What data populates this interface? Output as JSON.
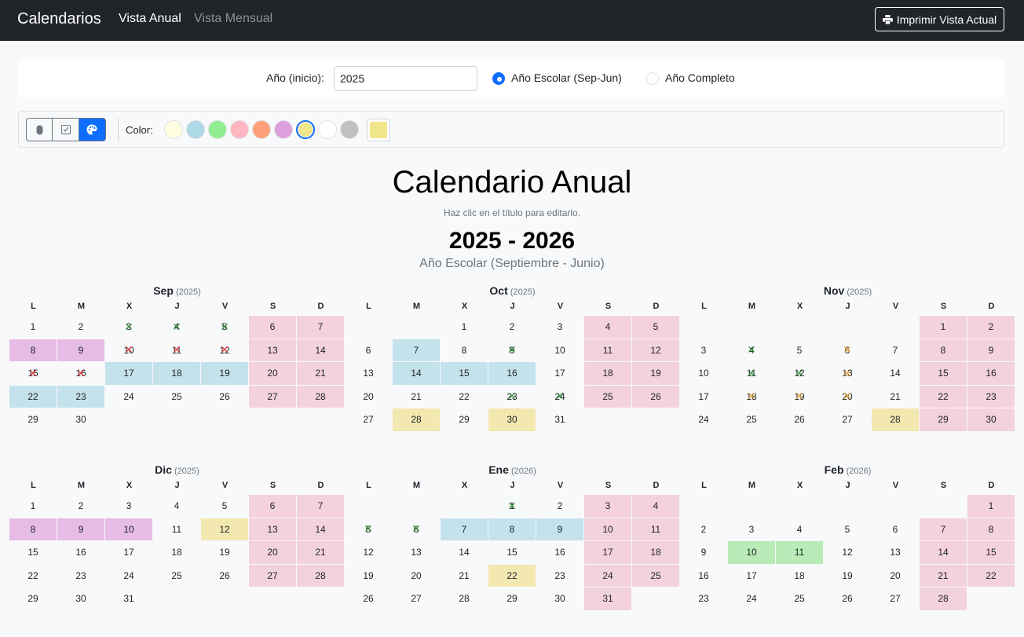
{
  "navbar": {
    "brand": "Calendarios",
    "nav": [
      "Vista Anual",
      "Vista Mensual"
    ],
    "print_label": "Imprimir Vista Actual"
  },
  "year_panel": {
    "label": "Año (inicio):",
    "value": "2025",
    "options": [
      {
        "label": "Año Escolar (Sep-Jun)",
        "checked": true
      },
      {
        "label": "Año Completo",
        "checked": false
      }
    ]
  },
  "toolbar": {
    "tools": [
      "mouse-icon",
      "checkbox-icon",
      "palette-icon"
    ],
    "active_tool": 2,
    "color_label": "Color:",
    "swatches": [
      "#fffde0",
      "#add8e6",
      "#90ee90",
      "#ffb6c1",
      "#ffa07a",
      "#dda0dd",
      "#f0e68c",
      "#ffffff",
      "#c0c0c0"
    ],
    "selected_swatch": 6,
    "custom_color": "#f0e68c"
  },
  "calendar": {
    "title": "Calendario Anual",
    "hint": "Haz clic en el título para editarlo.",
    "years": "2025 - 2026",
    "subtitle": "Año Escolar (Septiembre - Junio)",
    "weekdays": [
      "L",
      "M",
      "X",
      "J",
      "V",
      "S",
      "D"
    ]
  },
  "colors": {
    "weekend": "#f3d2dc",
    "blue": "#c4e2ec",
    "purple": "#e6bce6",
    "yellow": "#f2e8b0",
    "green": "#b8ebb8",
    "mark_red": "#e03030",
    "mark_green": "#2e8b2e",
    "mark_orange": "#f0a020"
  },
  "months": [
    {
      "name": "Sep",
      "year": "(2025)",
      "offset": 0,
      "days": 30,
      "weekend_color": true,
      "colors": {
        "8": "purple",
        "9": "purple",
        "17": "blue",
        "18": "blue",
        "19": "blue",
        "22": "blue",
        "23": "blue"
      },
      "marks": {
        "3": "green",
        "4": "green",
        "5": "green",
        "10": "red",
        "11": "red",
        "12": "red",
        "15": "red",
        "16": "red"
      }
    },
    {
      "name": "Oct",
      "year": "(2025)",
      "offset": 2,
      "days": 31,
      "weekend_color": true,
      "colors": {
        "7": "blue",
        "14": "blue",
        "15": "blue",
        "16": "blue",
        "28": "yellow",
        "30": "yellow"
      },
      "marks": {
        "9": "green",
        "23": "green",
        "24": "green"
      }
    },
    {
      "name": "Nov",
      "year": "(2025)",
      "offset": 5,
      "days": 30,
      "weekend_color": true,
      "colors": {
        "28": "yellow"
      },
      "marks": {
        "4": "green",
        "6": "orange",
        "11": "green",
        "12": "green",
        "13": "orange",
        "18": "orange",
        "19": "orange",
        "20": "orange"
      }
    },
    {
      "name": "Dic",
      "year": "(2025)",
      "offset": 0,
      "days": 31,
      "weekend_color": true,
      "colors": {
        "8": "purple",
        "9": "purple",
        "10": "purple",
        "12": "yellow"
      },
      "marks": {}
    },
    {
      "name": "Ene",
      "year": "(2026)",
      "offset": 3,
      "days": 31,
      "weekend_color": true,
      "colors": {
        "7": "blue",
        "8": "blue",
        "9": "blue",
        "22": "yellow"
      },
      "marks": {
        "1": "green",
        "5": "green",
        "6": "green"
      }
    },
    {
      "name": "Feb",
      "year": "(2026)",
      "offset": 6,
      "days": 28,
      "weekend_color": true,
      "colors": {
        "10": "green",
        "11": "green"
      },
      "marks": {}
    }
  ]
}
